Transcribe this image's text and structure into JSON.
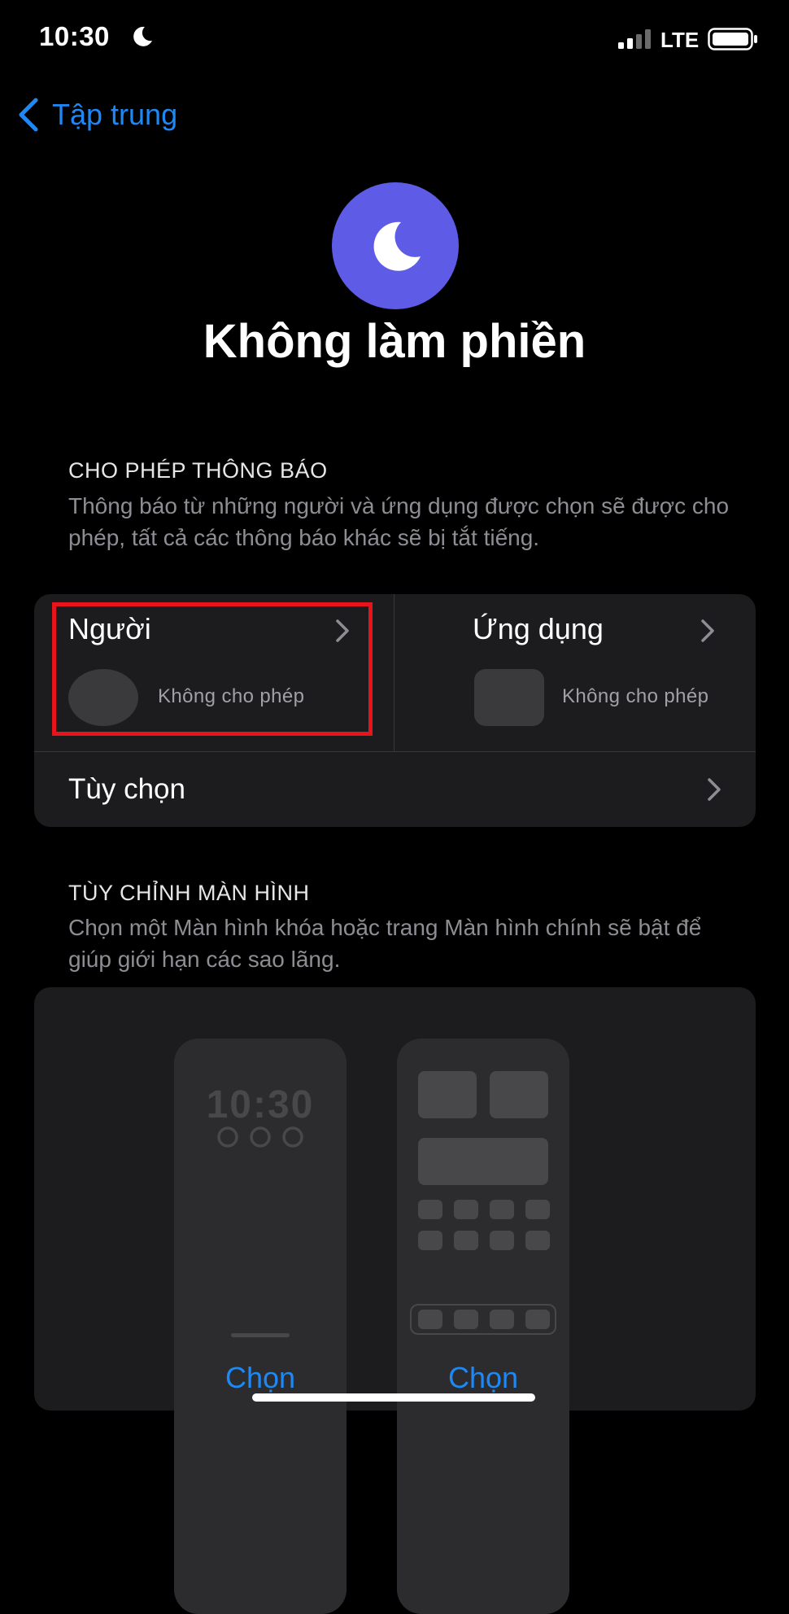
{
  "status_bar": {
    "time": "10:30",
    "network": "LTE",
    "icons": [
      "moon-icon",
      "signal-icon",
      "battery-icon"
    ]
  },
  "nav": {
    "back_label": "Tập trung"
  },
  "header": {
    "title": "Không làm phiền",
    "icon": "moon-icon",
    "icon_color": "#5e5ce6"
  },
  "allow_notifications": {
    "heading": "CHO PHÉP THÔNG BÁO",
    "description": "Thông báo từ những người và ứng dụng được chọn sẽ được cho phép, tất cả các thông báo khác sẽ bị tắt tiếng.",
    "people": {
      "label": "Người",
      "status": "Không cho phép"
    },
    "apps": {
      "label": "Ứng dụng",
      "status": "Không cho phép"
    },
    "options_label": "Tùy chọn"
  },
  "customize_screens": {
    "heading": "TÙY CHỈNH MÀN HÌNH",
    "description": "Chọn một Màn hình khóa hoặc trang Màn hình chính sẽ bật để giúp giới hạn các sao lãng.",
    "lock_screen_time": "10:30",
    "choose_lock_label": "Chọn",
    "choose_home_label": "Chọn"
  },
  "colors": {
    "accent": "#1e88f5",
    "highlight": "#e8141b",
    "background": "#000000",
    "card": "#1c1c1e"
  }
}
